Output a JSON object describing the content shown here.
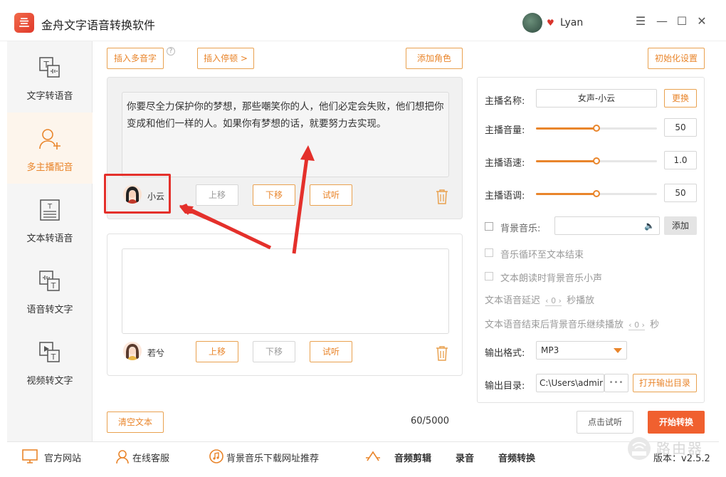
{
  "app": {
    "title": "金舟文字语音转换软件",
    "logo_glyph": "亖"
  },
  "user": {
    "name": "Lyan"
  },
  "window": {
    "minimize": "—",
    "maximize": "☐",
    "close": "✕",
    "menu": "☰"
  },
  "sidebar": {
    "items": [
      {
        "label": "文字转语音"
      },
      {
        "label": "多主播配音"
      },
      {
        "label": "文本转语音"
      },
      {
        "label": "语音转文字"
      },
      {
        "label": "视频转文字"
      }
    ]
  },
  "toolbar": {
    "insert_polyphone": "插入多音字",
    "help": "?",
    "insert_pause": "插入停顿 >",
    "add_role": "添加角色",
    "reset_settings": "初始化设置"
  },
  "roles": [
    {
      "text": "你要尽全力保护你的梦想，那些嘲笑你的人，他们必定会失败，他们想把你变成和他们一样的人。如果你有梦想的话，就要努力去实现。",
      "name": "小云",
      "move_up": "上移",
      "move_down": "下移",
      "preview": "试听"
    },
    {
      "text": "",
      "name": "若兮",
      "move_up": "上移",
      "move_down": "下移",
      "preview": "试听"
    }
  ],
  "footer_actions": {
    "clear_text": "清空文本",
    "char_count": "60/5000",
    "click_preview": "点击试听",
    "start_convert": "开始转换"
  },
  "settings": {
    "anchor_name_label": "主播名称:",
    "anchor_name_value": "女声-小云",
    "change_button": "更换",
    "volume_label": "主播音量:",
    "volume_value": "50",
    "speed_label": "主播语速:",
    "speed_value": "1.0",
    "pitch_label": "主播语调:",
    "pitch_value": "50",
    "bg_music_label": "背景音乐:",
    "bg_music_add": "添加",
    "loop_label": "音乐循环至文本结束",
    "lower_bg_label": "文本朗读时背景音乐小声",
    "delay_prefix": "文本语音延迟",
    "delay_value": "0",
    "delay_suffix": "秒播放",
    "continue_prefix": "文本语音结束后背景音乐继续播放",
    "continue_value": "0",
    "continue_suffix": "秒",
    "format_label": "输出格式:",
    "format_value": "MP3",
    "dir_label": "输出目录:",
    "dir_value": "C:\\Users\\admir",
    "dir_more": "•••",
    "open_dir": "打开输出目录"
  },
  "bottombar": {
    "website": "官方网站",
    "service": "在线客服",
    "bg_music_sites": "背景音乐下载网址推荐",
    "audio_edit": "音频剪辑",
    "record": "录音",
    "audio_convert": "音频转换",
    "version": "版本：v2.5.2"
  },
  "watermark": "路由器",
  "colors": {
    "accent": "#e9852b",
    "primary_button": "#f0602f",
    "annotation": "#e4302b"
  },
  "slider_levels": {
    "volume": 0.5,
    "speed": 0.5,
    "pitch": 0.5
  }
}
